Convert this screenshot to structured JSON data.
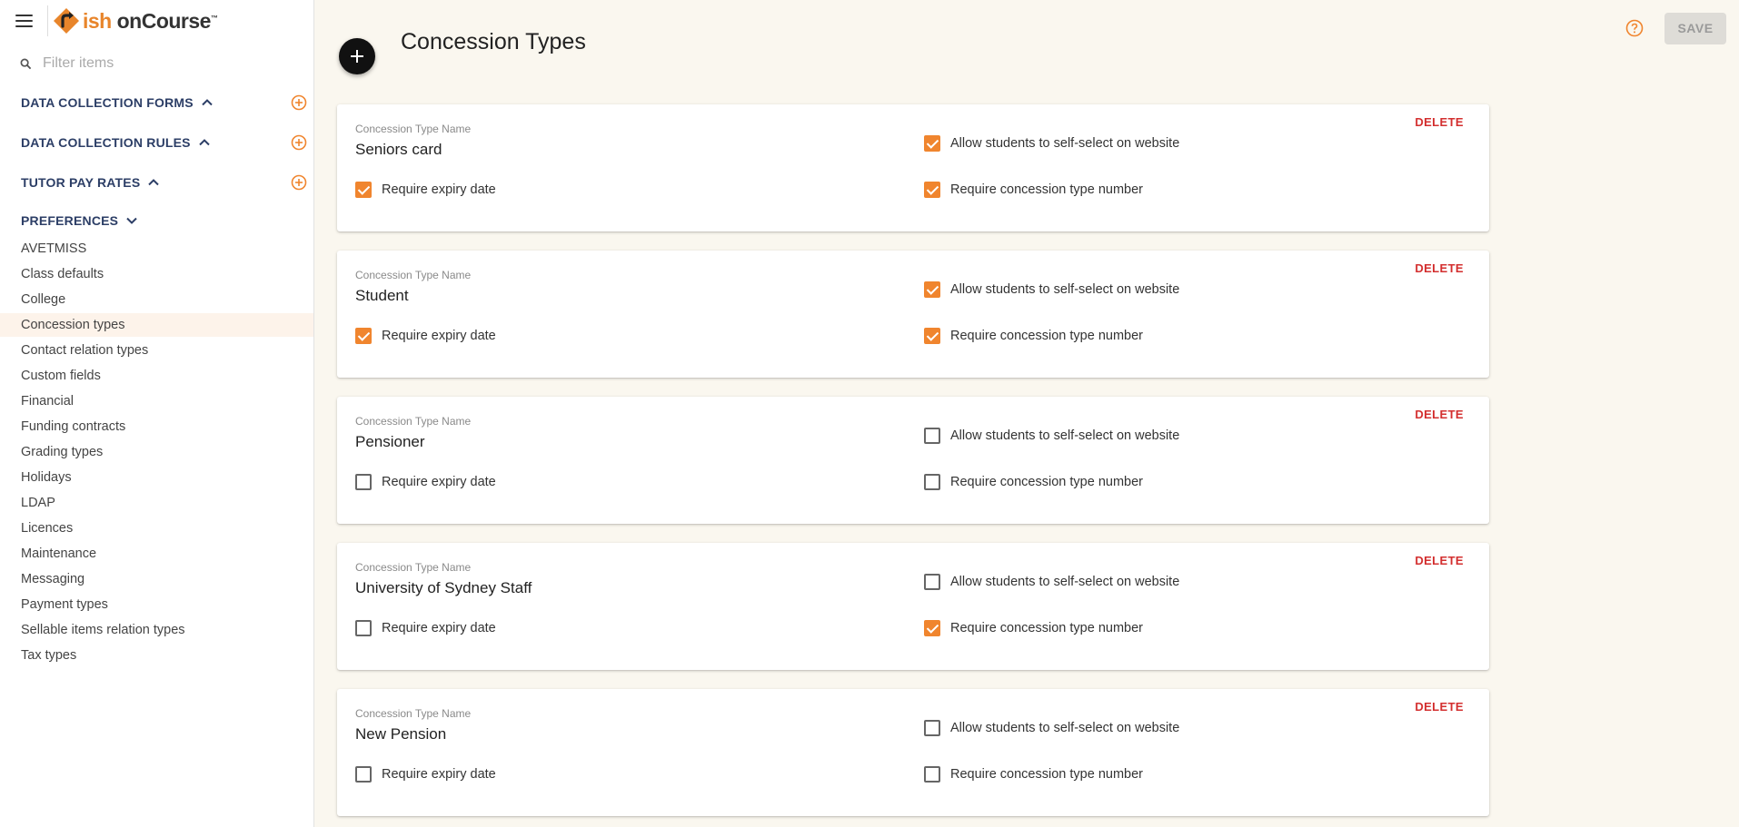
{
  "app": {
    "logo_brand": "ish",
    "logo_product": "onCourse",
    "logo_tm": "™"
  },
  "colors": {
    "accent": "#f0852e",
    "nav_heading": "#2c3e66",
    "delete": "#d32f2f",
    "background": "#faf7ef"
  },
  "sidebar": {
    "filter_placeholder": "Filter items",
    "groups": [
      {
        "label": "DATA COLLECTION FORMS",
        "expanded": false,
        "icon": "chevron-up-icon"
      },
      {
        "label": "DATA COLLECTION RULES",
        "expanded": false,
        "icon": "chevron-up-icon"
      },
      {
        "label": "TUTOR PAY RATES",
        "expanded": false,
        "icon": "chevron-up-icon"
      },
      {
        "label": "PREFERENCES",
        "expanded": true,
        "icon": "chevron-down-icon"
      }
    ],
    "items": [
      "AVETMISS",
      "Class defaults",
      "College",
      "Concession types",
      "Contact relation types",
      "Custom fields",
      "Financial",
      "Funding contracts",
      "Grading types",
      "Holidays",
      "LDAP",
      "Licences",
      "Maintenance",
      "Messaging",
      "Payment types",
      "Sellable items relation types",
      "Tax types"
    ],
    "active_item": "Concession types"
  },
  "header": {
    "title": "Concession Types",
    "save_label": "SAVE",
    "save_enabled": false
  },
  "labels": {
    "field_label": "Concession Type Name",
    "delete": "DELETE",
    "allow_self_select": "Allow students to self-select on website",
    "require_expiry": "Require expiry date",
    "require_number": "Require concession type number"
  },
  "concessions": [
    {
      "name": "Seniors card",
      "allow_self_select": true,
      "require_expiry": true,
      "require_number": true
    },
    {
      "name": "Student",
      "allow_self_select": true,
      "require_expiry": true,
      "require_number": true
    },
    {
      "name": "Pensioner",
      "allow_self_select": false,
      "require_expiry": false,
      "require_number": false
    },
    {
      "name": "University of Sydney Staff",
      "allow_self_select": false,
      "require_expiry": false,
      "require_number": true
    },
    {
      "name": "New Pension",
      "allow_self_select": false,
      "require_expiry": false,
      "require_number": false
    }
  ]
}
